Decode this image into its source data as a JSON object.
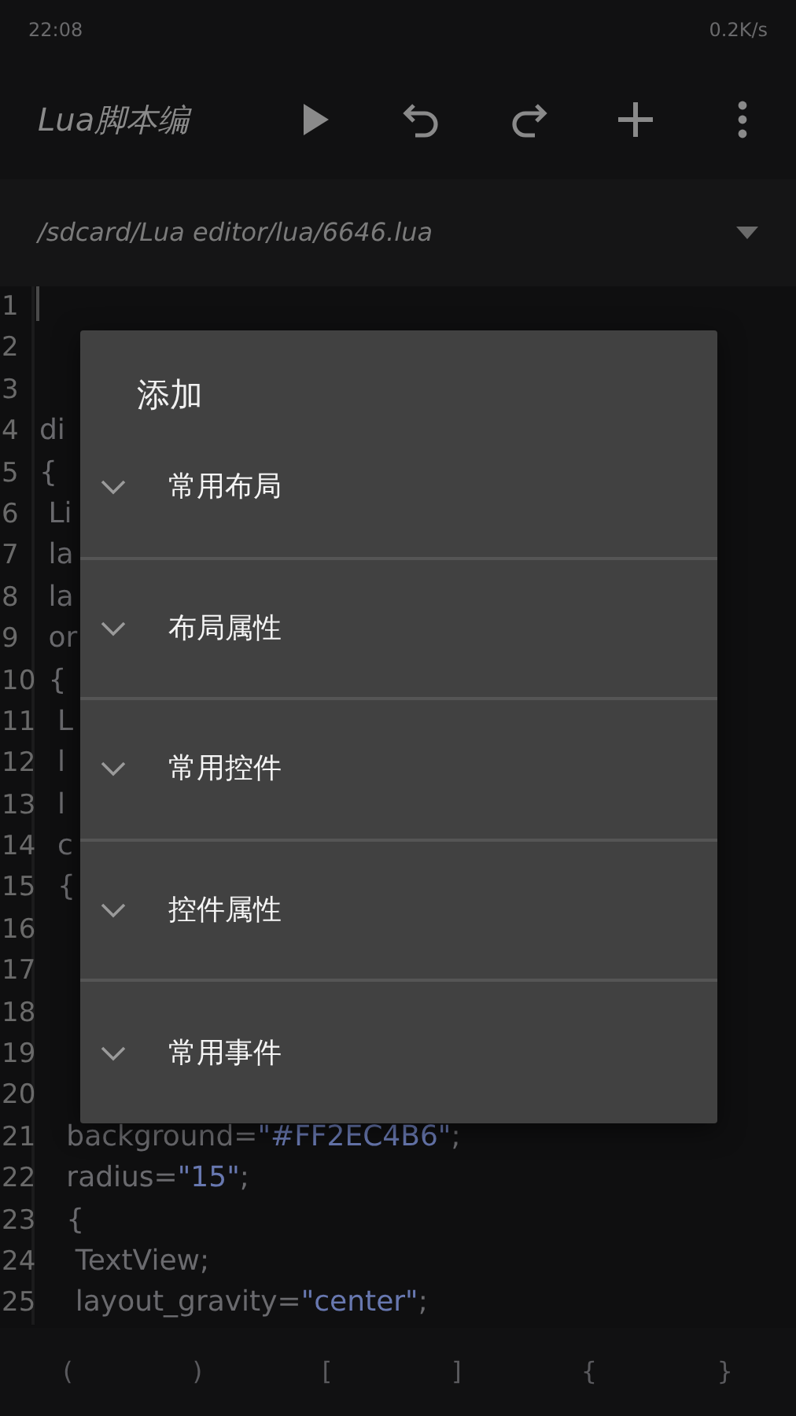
{
  "status_bar": {
    "time": "22:08",
    "speed": "0.2K/s"
  },
  "toolbar": {
    "title": "Lua脚本编",
    "actions": [
      {
        "kind": "run"
      },
      {
        "kind": "undo"
      },
      {
        "kind": "redo"
      },
      {
        "kind": "add"
      },
      {
        "kind": "more"
      }
    ]
  },
  "file_bar": {
    "path": "/sdcard/Lua editor/lua/6646.lua"
  },
  "editor": {
    "lines": [
      {
        "number": "1"
      },
      {
        "number": "2"
      },
      {
        "number": "3"
      },
      {
        "number": "4",
        "segments": [
          {
            "text": "di",
            "kind": "plain"
          }
        ]
      },
      {
        "number": "5",
        "segments": [
          {
            "text": "{",
            "kind": "plain"
          }
        ]
      },
      {
        "number": "6",
        "segments": [
          {
            "text": " Li",
            "kind": "plain"
          }
        ]
      },
      {
        "number": "7",
        "segments": [
          {
            "text": " la",
            "kind": "plain"
          }
        ]
      },
      {
        "number": "8",
        "segments": [
          {
            "text": " la",
            "kind": "plain"
          }
        ]
      },
      {
        "number": "9",
        "segments": [
          {
            "text": " or",
            "kind": "plain"
          }
        ]
      },
      {
        "number": "10",
        "segments": [
          {
            "text": " {",
            "kind": "plain"
          }
        ]
      },
      {
        "number": "11",
        "segments": [
          {
            "text": "  L",
            "kind": "plain"
          }
        ]
      },
      {
        "number": "12",
        "segments": [
          {
            "text": "  l",
            "kind": "plain"
          }
        ]
      },
      {
        "number": "13",
        "segments": [
          {
            "text": "  l",
            "kind": "plain"
          }
        ]
      },
      {
        "number": "14",
        "segments": [
          {
            "text": "  c",
            "kind": "plain"
          }
        ]
      },
      {
        "number": "15",
        "segments": [
          {
            "text": "  {",
            "kind": "plain"
          }
        ]
      },
      {
        "number": "16"
      },
      {
        "number": "17"
      },
      {
        "number": "18"
      },
      {
        "number": "19"
      },
      {
        "number": "20"
      },
      {
        "number": "21",
        "segments": [
          {
            "text": "   background=",
            "kind": "plain"
          },
          {
            "text": "\"#FF2EC4B6\"",
            "kind": "string"
          },
          {
            "text": ";",
            "kind": "plain"
          }
        ]
      },
      {
        "number": "22",
        "segments": [
          {
            "text": "   radius=",
            "kind": "plain"
          },
          {
            "text": "\"15\"",
            "kind": "string"
          },
          {
            "text": ";",
            "kind": "plain"
          }
        ]
      },
      {
        "number": "23",
        "segments": [
          {
            "text": "   {",
            "kind": "plain"
          }
        ]
      },
      {
        "number": "24",
        "segments": [
          {
            "text": "    TextView;",
            "kind": "plain"
          }
        ]
      },
      {
        "number": "25",
        "segments": [
          {
            "text": "    layout_gravity=",
            "kind": "plain"
          },
          {
            "text": "\"center\"",
            "kind": "string"
          },
          {
            "text": ";",
            "kind": "plain"
          }
        ]
      }
    ]
  },
  "symbol_bar": [
    "(",
    ")",
    "[",
    "]",
    "{",
    "}"
  ],
  "dialog": {
    "title": "添加",
    "items": [
      {
        "label": "常用布局",
        "expanded": false
      },
      {
        "label": "布局属性",
        "expanded": false
      },
      {
        "label": "常用控件",
        "expanded": false
      },
      {
        "label": "控件属性",
        "expanded": false
      },
      {
        "label": "常用事件",
        "expanded": false
      }
    ]
  }
}
